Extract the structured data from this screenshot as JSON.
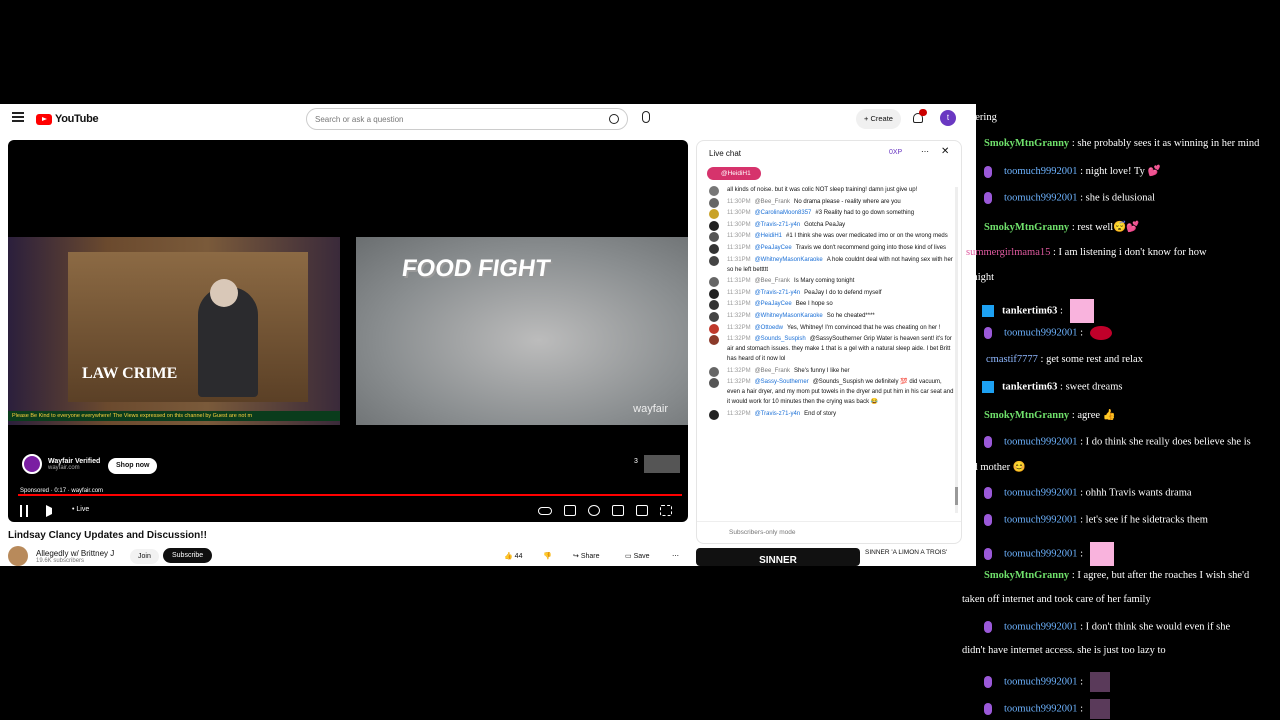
{
  "youtube": {
    "logo_text": "YouTube",
    "search_placeholder": "Search or ask a question",
    "create_label": "Create",
    "avatar_letter": "t",
    "video": {
      "lawcrime": "LAW CRIME",
      "ticker": "Please Be Kind to everyone everywhere! The Views expressed on this channel by Guest are not m",
      "food_fight": "FOOD FIGHT",
      "wayfair_mark": "wayfair",
      "ad_name": "Wayfair Verified",
      "ad_domain": "wayfair.com",
      "shop_now": "Shop now",
      "up_next_count": "3",
      "sponsored": "Sponsored · 0:17 · wayfair.com",
      "live": "• Live",
      "progress_fraction": 1.0
    },
    "title": "Lindsay Clancy Updates and Discussion!!",
    "channel_name": "Allegedly w/ Brittney J",
    "channel_subs": "19.6K subscribers",
    "join": "Join",
    "subscribe": "Subscribe",
    "likes": "44",
    "share": "Share",
    "save": "Save",
    "chat": {
      "header": "Live chat",
      "xp": "0XP",
      "pinned": "@HeidiH1",
      "footer": "Subscribers-only mode",
      "messages": [
        {
          "time": "",
          "user": "",
          "text": "all kinds of noise. but it was colic NOT sleep training! damn just give up!",
          "color": "#777"
        },
        {
          "time": "11:30PM",
          "user": "@Bee_Frank",
          "text": "No drama please - reality where are you",
          "color": "#666"
        },
        {
          "time": "11:30PM",
          "user": "@CarolinaMoon8357",
          "text": "#3 Reality had to go down something",
          "color": "#c9a227"
        },
        {
          "time": "11:30PM",
          "user": "@Travis-z71-y4n",
          "text": "Gotcha PeaJay",
          "color": "#222"
        },
        {
          "time": "11:30PM",
          "user": "@HeidiH1",
          "text": "#1 I think she was over medicated imo or on the wrong meds",
          "color": "#555"
        },
        {
          "time": "11:31PM",
          "user": "@PeaJayCee",
          "text": "Travis we don't recommend going into those kind of lives",
          "color": "#333"
        },
        {
          "time": "11:31PM",
          "user": "@WhitneyMasonKaraoke",
          "text": "A hole couldnt deal with not having sex with her so he left bettttt",
          "color": "#444"
        },
        {
          "time": "11:31PM",
          "user": "@Bee_Frank",
          "text": "Is Mary coming tonight",
          "color": "#666"
        },
        {
          "time": "11:31PM",
          "user": "@Travis-z71-y4n",
          "text": "PeaJay I do to defend myself",
          "color": "#222"
        },
        {
          "time": "11:31PM",
          "user": "@PeaJayCee",
          "text": "Bee I hope so",
          "color": "#333"
        },
        {
          "time": "11:32PM",
          "user": "@WhitneyMasonKaraoke",
          "text": "So he cheated****",
          "color": "#444"
        },
        {
          "time": "11:32PM",
          "user": "@Ottoedw",
          "text": "Yes, Whitney! I'm convinced that he was cheating on her !",
          "color": "#c0392b"
        },
        {
          "time": "11:32PM",
          "user": "@Sounds_Suspish",
          "text": "@SassySoutherner Grip Water is heaven sent! it's for air and stomach issues. they make 1 that is a gel with a natural sleep aide. I bet Britt has heard of it now lol",
          "color": "#8b3a2a"
        },
        {
          "time": "11:32PM",
          "user": "@Bee_Frank",
          "text": "She's funny I like her",
          "color": "#666"
        },
        {
          "time": "11:32PM",
          "user": "@Sassy-Southerner",
          "text": "@Sounds_Suspish we definitely 💯 did vacuum, even a hair dryer, and my mom put towels in the dryer and put him in his car seat and it would work for 10 minutes then the crying was back 😂",
          "color": "#555"
        },
        {
          "time": "11:32PM",
          "user": "@Travis-z71-y4n",
          "text": "End of story",
          "color": "#222"
        }
      ]
    },
    "rec_thumb": "SINNER",
    "rec_title": "SINNER 'A LIMON A TROIS'"
  },
  "stream_chat": [
    {
      "user": "",
      "text": "vering",
      "type": "plain"
    },
    {
      "user": "SmokyMtnGranny",
      "text": " : she probably sees it as winning in her mind",
      "type": "green"
    },
    {
      "user": "toomuch9992001",
      "text": " : night love! Ty 💕",
      "type": "mic"
    },
    {
      "user": "toomuch9992001",
      "text": " : she is delusional",
      "type": "mic"
    },
    {
      "user": "SmokyMtnGranny",
      "text": " : rest well😴💕",
      "type": "green"
    },
    {
      "user": "summergirlmama15",
      "text": " : I am listening i don't know for how",
      "type": "pink"
    },
    {
      "user": "",
      "text": "g..night",
      "type": "plain"
    },
    {
      "user": "tankertim63",
      "text": " : ",
      "type": "tanker"
    },
    {
      "user": "toomuch9992001",
      "text": " : ",
      "type": "mic"
    },
    {
      "user": "cmastif7777",
      "text": " : get some rest and relax",
      "type": "cyan"
    },
    {
      "user": "tankertim63",
      "text": " : sweet dreams",
      "type": "tanker"
    },
    {
      "user": "SmokyMtnGranny",
      "text": " : agree 👍",
      "type": "green"
    },
    {
      "user": "toomuch9992001",
      "text": " : I do think she really does believe she is",
      "type": "mic"
    },
    {
      "user": "",
      "text": "ood mother 😊",
      "type": "plain"
    },
    {
      "user": "toomuch9992001",
      "text": " : ohhh Travis wants drama",
      "type": "mic"
    },
    {
      "user": "toomuch9992001",
      "text": " : let's see if he sidetracks them",
      "type": "mic"
    },
    {
      "user": "toomuch9992001",
      "text": " : ",
      "type": "mic"
    },
    {
      "user": "SmokyMtnGranny",
      "text": " : I agree, but after the roaches I wish she'd",
      "type": "green"
    },
    {
      "user": "",
      "text": "taken off internet and took care of her family",
      "type": "plain"
    },
    {
      "user": "toomuch9992001",
      "text": " : I don't think she would even if she",
      "type": "mic"
    },
    {
      "user": "",
      "text": "didn't have internet access. she is just too lazy to",
      "type": "plain"
    },
    {
      "user": "toomuch9992001",
      "text": " : ",
      "type": "mic"
    },
    {
      "user": "toomuch9992001",
      "text": " : ",
      "type": "mic"
    }
  ]
}
